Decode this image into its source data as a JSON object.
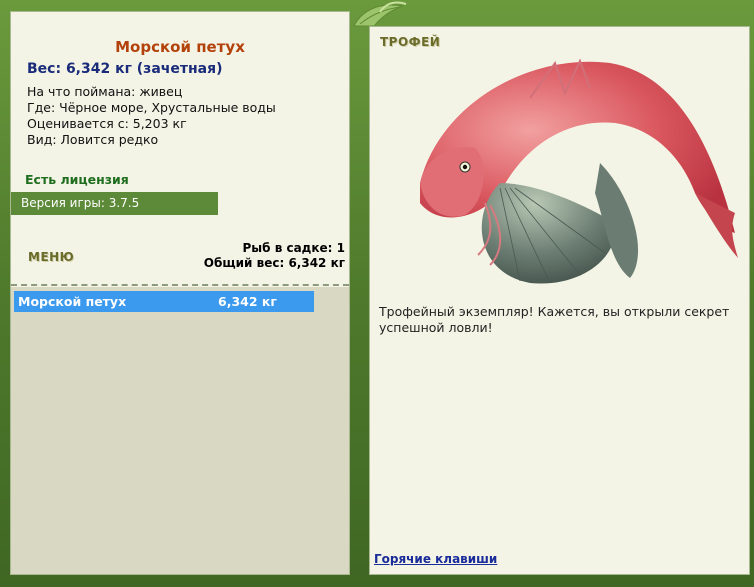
{
  "fish": {
    "name": "Морской петух",
    "weight_line": "Вес: 6,342 кг (зачетная)",
    "bait": "На что поймана: живец",
    "where": "Где: Чёрное море, Хрустальные воды",
    "estimate": "Оценивается с: 5,203 кг",
    "kind": "Вид: Ловится редко"
  },
  "license": "Есть лицензия",
  "version": "Версия игры: 3.7.5",
  "menu_title": "МЕНЮ",
  "keepnet": {
    "count_line": "Рыб в садке: 1",
    "total_line": "Общий вес: 6,342 кг",
    "rows": [
      {
        "name": "Морской петух",
        "weight": "6,342 кг"
      }
    ]
  },
  "trophy": {
    "title": "ТРОФЕЙ",
    "text": "Трофейный экземпляр! Кажется, вы открыли секрет успешной ловли!"
  },
  "hotkeys_label": "Горячие клавиши",
  "colors": {
    "frame": "#4f7a2c",
    "panel": "#f4f4e6",
    "title_red": "#b3420a",
    "weight_blue": "#1a2b7a",
    "selected_row": "#3b99ee"
  }
}
